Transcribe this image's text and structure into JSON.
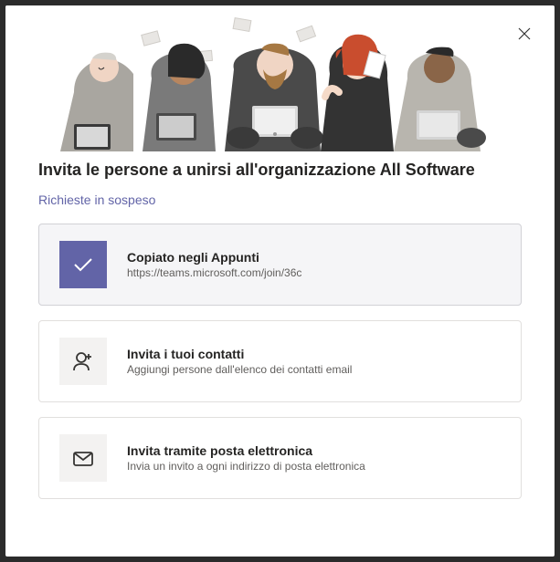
{
  "dialog": {
    "title": "Invita le persone a unirsi all'organizzazione All Software",
    "pending_link": "Richieste in sospeso"
  },
  "options": {
    "copied": {
      "title": "Copiato negli Appunti",
      "subtitle": "https://teams.microsoft.com/join/36c"
    },
    "contacts": {
      "title": "Invita i tuoi contatti",
      "subtitle": "Aggiungi persone dall'elenco dei contatti email"
    },
    "email": {
      "title": "Invita tramite posta elettronica",
      "subtitle": "Invia un invito a ogni indirizzo di posta elettronica"
    }
  }
}
